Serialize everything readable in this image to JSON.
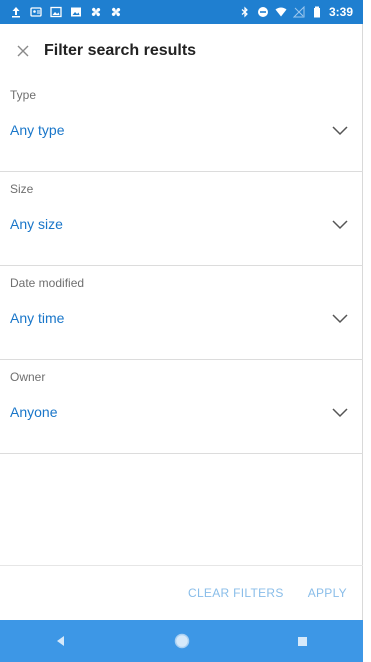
{
  "status_bar": {
    "time": "3:39",
    "left_icons": [
      "upload-icon",
      "contact-card-icon",
      "image-icon",
      "photo-icon",
      "fan-icon",
      "fan-icon"
    ],
    "right_icons": [
      "bluetooth-icon",
      "do-not-disturb-icon",
      "wifi-icon",
      "no-signal-icon",
      "battery-icon"
    ]
  },
  "header": {
    "title": "Filter search results",
    "close_icon": "close-icon"
  },
  "filters": [
    {
      "label": "Type",
      "value": "Any type"
    },
    {
      "label": "Size",
      "value": "Any size"
    },
    {
      "label": "Date modified",
      "value": "Any time"
    },
    {
      "label": "Owner",
      "value": "Anyone"
    }
  ],
  "footer": {
    "clear_label": "CLEAR FILTERS",
    "apply_label": "APPLY"
  },
  "navbar": {
    "icons": [
      "back-icon",
      "home-icon",
      "recents-icon"
    ]
  },
  "colors": {
    "status_bar": "#1f7fd0",
    "nav_bar": "#3d97e6",
    "value_text": "#1976c9",
    "footer_text": "#89bde9"
  }
}
